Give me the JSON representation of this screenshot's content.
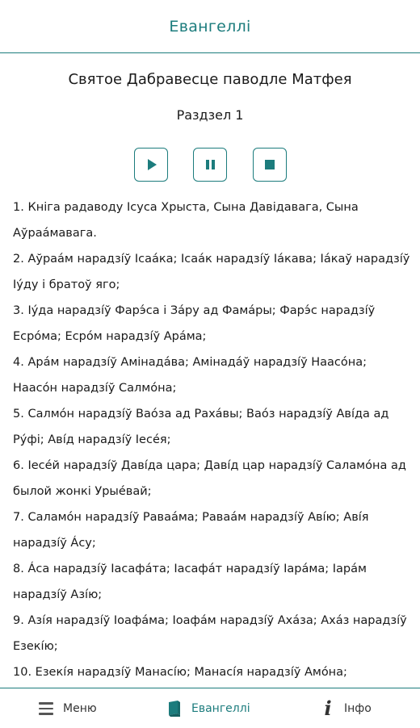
{
  "header": {
    "title": "Евангеллі"
  },
  "book_title": "Святое Дабравесце паводле Матфея",
  "chapter_title": "Раздзел 1",
  "player": {
    "play_icon": "play-icon",
    "pause_icon": "pause-icon",
    "stop_icon": "stop-icon"
  },
  "verses": [
    "1. Кніга радаводу Ісуса Хрыста, Сына Давідавага, Сына Аўраáмавага.",
    "2. Аўраáм нарадзíў Ісаáка; Ісаáк нарадзíў Іáкава; Іáкаў нарадзíў Іýду і братоў яго;",
    "3. Іýда нарадзíў Фарэ́са і Зáру ад Фамáры; Фарэ́с нарадзíў Есрóма; Есрóм нарадзíў Арáма;",
    "4. Арáм нарадзíў Амінадáва; Амінадáў нарадзíў Наасóна; Наасóн нарадзíў Салмóна;",
    "5. Салмóн нарадзíў Ваóза ад Рахáвы; Ваóз нарадзíў Авíда ад Рýфі; Авíд нарадзíў Іесéя;",
    "6. Іесéй нарадзíў Давíда цара; Давíд цар нарадзíў Саламóна ад былой жонкі Урыéвай;",
    "7. Саламóн нарадзíў Раваáма; Раваáм нарадзíў Авíю; Авíя нарадзíў Áсу;",
    "8. Áса нарадзíў Іасафáта; Іасафáт нарадзíў Іарáма; Іарáм нарадзíў Азíю;",
    "9. Азíя нарадзíў Іоафáма; Іоафáм нарадзíў Ахáза; Ахáз нарадзíў Езекíю;",
    "10. Езекíя нарадзíў Манасíю; Манасíя нарадзíў Амóна;"
  ],
  "footer": {
    "menu": {
      "label": "Меню",
      "icon": "menu-icon"
    },
    "gospel": {
      "label": "Евангеллі",
      "icon": "book-icon",
      "active": true
    },
    "info": {
      "label": "Інфо",
      "icon": "info-icon"
    }
  },
  "colors": {
    "accent": "#1c7c7d",
    "text": "#1a1a1a",
    "background": "#ffffff"
  }
}
